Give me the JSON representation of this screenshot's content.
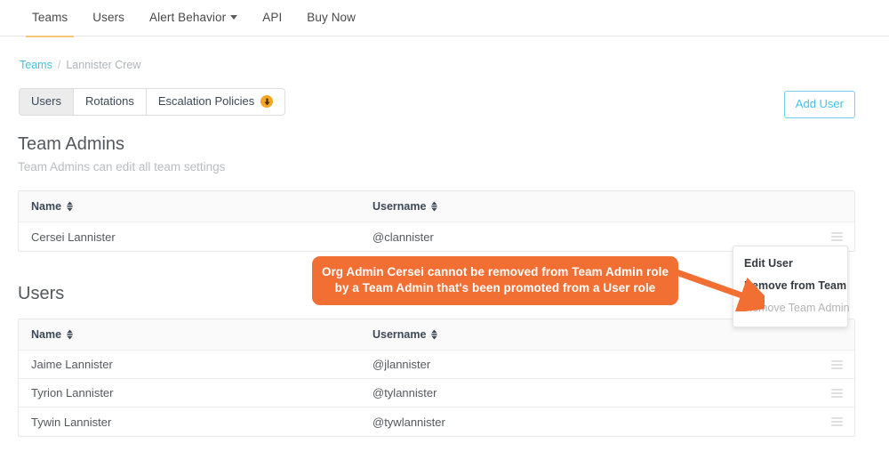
{
  "topnav": {
    "items": [
      {
        "label": "Teams",
        "active": true,
        "caret": false
      },
      {
        "label": "Users",
        "active": false,
        "caret": false
      },
      {
        "label": "Alert Behavior",
        "active": false,
        "caret": true
      },
      {
        "label": "API",
        "active": false,
        "caret": false
      },
      {
        "label": "Buy Now",
        "active": false,
        "caret": false
      }
    ]
  },
  "breadcrumb": {
    "root": "Teams",
    "separator": "/",
    "current": "Lannister Crew"
  },
  "segments": [
    {
      "label": "Users",
      "active": true,
      "badge": false
    },
    {
      "label": "Rotations",
      "active": false,
      "badge": false
    },
    {
      "label": "Escalation Policies",
      "active": false,
      "badge": true,
      "badge_icon": "arrow-down-badge-icon"
    }
  ],
  "actions": {
    "add_user_label": "Add User"
  },
  "team_admins": {
    "title": "Team Admins",
    "subtitle": "Team Admins can edit all team settings",
    "columns": [
      {
        "label": "Name",
        "sort_icon": "sort-icon"
      },
      {
        "label": "Username",
        "sort_icon": "sort-icon"
      }
    ],
    "rows": [
      {
        "name": "Cersei Lannister",
        "username": "@clannister",
        "menu_icon": "row-menu-icon"
      }
    ]
  },
  "users": {
    "title": "Users",
    "columns": [
      {
        "label": "Name",
        "sort_icon": "sort-icon"
      },
      {
        "label": "Username",
        "sort_icon": "sort-icon"
      }
    ],
    "rows": [
      {
        "name": "Jaime Lannister",
        "username": "@jlannister",
        "menu_icon": "row-menu-icon"
      },
      {
        "name": "Tyrion Lannister",
        "username": "@tylannister",
        "menu_icon": "row-menu-icon"
      },
      {
        "name": "Tywin Lannister",
        "username": "@tywlannister",
        "menu_icon": "row-menu-icon"
      }
    ]
  },
  "dropdown": {
    "items": [
      {
        "label": "Edit User",
        "disabled": false
      },
      {
        "label": "Remove from Team",
        "disabled": false
      },
      {
        "label": "Remove Team Admin",
        "disabled": true
      }
    ]
  },
  "callout": {
    "line1": "Org Admin Cersei cannot be removed from Team Admin role",
    "line2": "by a Team Admin that's been promoted from a User role",
    "color": "#f26f33"
  },
  "colors": {
    "accent_orange": "#f26f33",
    "badge_orange": "#f5a623",
    "link_cyan": "#46c0e8",
    "active_tab_underline": "#f4c77b",
    "text_primary": "#3c4858",
    "text_muted": "#b9bdc2"
  }
}
